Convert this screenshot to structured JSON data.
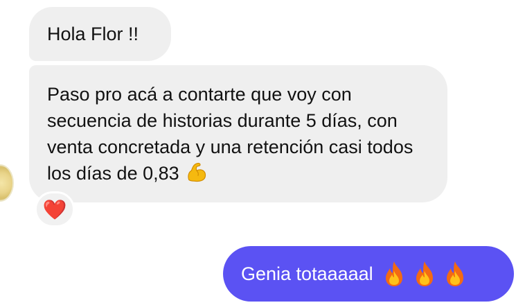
{
  "messages": {
    "incoming": [
      {
        "text": "Hola Flor !!"
      },
      {
        "text": "Paso pro acá a contarte que voy con secuencia de historias durante 5 días, con venta concretada y una retención casi todos los días de 0,83",
        "emoji": "flexed-biceps"
      }
    ],
    "reaction": {
      "emoji": "❤️",
      "color": "#ff2d2d"
    },
    "outgoing": [
      {
        "text": "Genia totaaaaal",
        "emoji_count": 3,
        "emoji": "fire"
      }
    ]
  },
  "colors": {
    "incoming_bubble": "#efefef",
    "outgoing_bubble": "#5b52f3",
    "text_dark": "#111111",
    "text_light": "#ffffff"
  }
}
